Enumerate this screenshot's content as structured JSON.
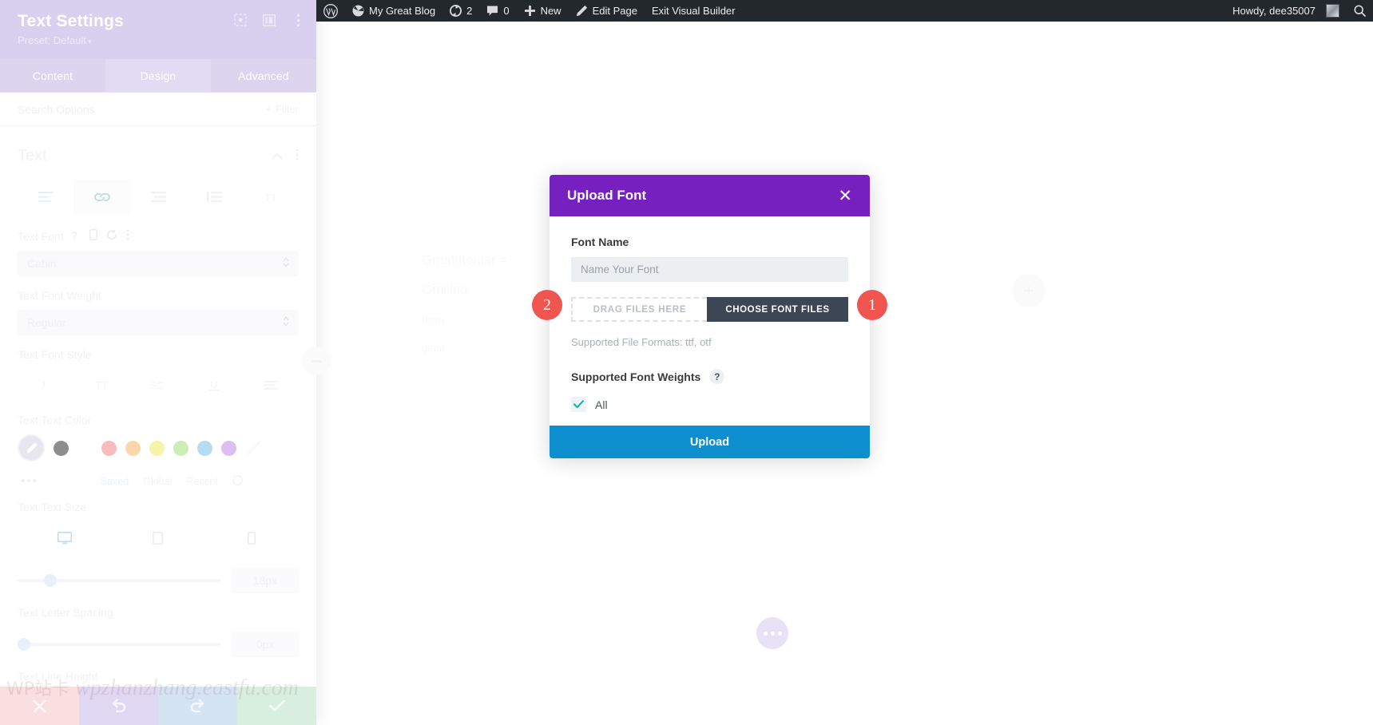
{
  "adminbar": {
    "wp_logo": "wordpress-logo-icon",
    "items": [
      {
        "icon": "dashboard-icon",
        "label": "My Great Blog",
        "name": "site-name"
      },
      {
        "icon": "updates-icon",
        "label": "2",
        "name": "updates"
      },
      {
        "icon": "comments-icon",
        "label": "0",
        "name": "comments"
      },
      {
        "icon": "plus-icon",
        "label": "New",
        "name": "new-content"
      },
      {
        "icon": "pencil-icon",
        "label": "Edit Page",
        "name": "edit-page"
      },
      {
        "icon": "",
        "label": "Exit Visual Builder",
        "name": "exit-visual-builder"
      }
    ],
    "howdy": "Howdy, dee35007",
    "search_icon": "search-icon",
    "avatar": "user-avatar"
  },
  "panel": {
    "title": "Text Settings",
    "preset": "Preset: Default",
    "preset_caret": "▾",
    "header_icons": [
      "target-icon",
      "layout-columns-icon",
      "kebab-menu-icon"
    ],
    "tabs": [
      {
        "label": "Content",
        "active": false
      },
      {
        "label": "Design",
        "active": true
      },
      {
        "label": "Advanced",
        "active": false
      }
    ],
    "search_placeholder": "Search Options",
    "filter_label": "Filter",
    "section_title": "Text",
    "toolbar_icons": [
      "align-text-icon",
      "link-icon",
      "list-icon",
      "quote-icon",
      "heading-icon"
    ],
    "fields": {
      "text_font": {
        "label": "Text Font",
        "value": "Cabin",
        "icons": [
          "help-icon",
          "responsive-icon",
          "reset-icon",
          "kebab-menu-icon"
        ]
      },
      "text_font_weight": {
        "label": "Text Font Weight",
        "value": "Regular"
      },
      "text_font_style": {
        "label": "Text Font Style"
      },
      "text_text_color": {
        "label": "Text Text Color",
        "swatches": [
          "#e8e6ee",
          "#8d8d8d",
          "#ffffff",
          "#f7bcbc",
          "#fad7a8",
          "#f6f4a8",
          "#cdedb6",
          "#b9dbf2",
          "#ddbef0"
        ],
        "saved": "Saved",
        "global": "Global",
        "recent": "Recent"
      },
      "text_text_size": {
        "label": "Text Text Size",
        "value": "18px"
      },
      "text_letter_spacing": {
        "label": "Text Letter Spacing",
        "value": "0px"
      },
      "text_line_height": {
        "label": "Text Line Height"
      }
    },
    "footer_buttons": [
      {
        "name": "close-button",
        "icon": "x-icon",
        "color": "#f9dfe0"
      },
      {
        "name": "undo-button",
        "icon": "undo-icon",
        "color": "#e0d8f3"
      },
      {
        "name": "redo-button",
        "icon": "redo-icon",
        "color": "#d5e4f3"
      },
      {
        "name": "save-button",
        "icon": "check-icon",
        "color": "#d8eede"
      }
    ]
  },
  "canvas": {
    "ghost_lines": [
      "Gmahltonlar =",
      "Gmilinu",
      "term",
      "gmm"
    ],
    "add_module_icon": "plus-circle-icon",
    "fab_icon": "ellipsis-icon"
  },
  "modal": {
    "title": "Upload Font",
    "close_icon": "close-icon",
    "font_name_label": "Font Name",
    "font_name_value": "",
    "font_name_placeholder": "Name Your Font",
    "drag_label": "DRAG FILES HERE",
    "choose_label": "CHOOSE FONT FILES",
    "formats_note": "Supported File Formats: ttf, otf",
    "weights_label": "Supported Font Weights",
    "weights_help": "?",
    "weights": [
      {
        "label": "All",
        "checked": true
      }
    ],
    "upload_label": "Upload",
    "badge_one": "1",
    "badge_two": "2",
    "colors": {
      "header": "#7620c0",
      "footer": "#0c8ecf",
      "choose_btn": "#3c4654",
      "badge": "#f0564f"
    }
  },
  "watermark": {
    "cn": "WP站卡",
    "url": "wpzhanzhang.eastfu.com"
  }
}
